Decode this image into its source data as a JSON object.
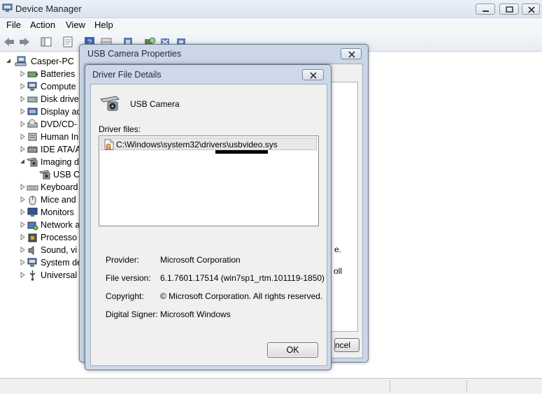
{
  "window": {
    "title": "Device Manager",
    "icon": "device-manager-icon"
  },
  "menu": {
    "file": "File",
    "action": "Action",
    "view": "View",
    "help": "Help"
  },
  "toolbar": {
    "icons": [
      "back-arrow-icon",
      "forward-arrow-icon",
      "console-tree-icon",
      "properties-icon",
      "help-icon",
      "grid-icon",
      "update-driver-icon",
      "scan-hardware-icon",
      "uninstall-icon",
      "disable-icon"
    ]
  },
  "tree": {
    "root": "Casper-PC",
    "items": [
      {
        "label": "Batteries",
        "icon": "battery-icon"
      },
      {
        "label": "Compute",
        "icon": "computer-icon"
      },
      {
        "label": "Disk drive",
        "icon": "disk-drive-icon"
      },
      {
        "label": "Display ad",
        "icon": "display-adapter-icon"
      },
      {
        "label": "DVD/CD-",
        "icon": "dvd-drive-icon"
      },
      {
        "label": "Human In",
        "icon": "hid-icon"
      },
      {
        "label": "IDE ATA/A",
        "icon": "ide-controller-icon"
      },
      {
        "label": "Imaging d",
        "icon": "camera-icon"
      },
      {
        "label": "USB C",
        "icon": "usb-camera-icon"
      },
      {
        "label": "Keyboard",
        "icon": "keyboard-icon"
      },
      {
        "label": "Mice and",
        "icon": "mouse-icon"
      },
      {
        "label": "Monitors",
        "icon": "monitor-icon"
      },
      {
        "label": "Network a",
        "icon": "network-adapter-icon"
      },
      {
        "label": "Processo",
        "icon": "processor-icon"
      },
      {
        "label": "Sound, vi",
        "icon": "sound-icon"
      },
      {
        "label": "System de",
        "icon": "system-devices-icon"
      },
      {
        "label": "Universal",
        "icon": "usb-controller-icon"
      }
    ]
  },
  "properties_dialog": {
    "title": "USB Camera Properties",
    "fragment_1": "e.",
    "fragment_2": "oll",
    "cancel_fragment": "ncel"
  },
  "details_dialog": {
    "title": "Driver File Details",
    "device_name": "USB Camera",
    "files_label": "Driver files:",
    "files": [
      "C:\\Windows\\system32\\drivers\\usbvideo.sys"
    ],
    "provider_label": "Provider:",
    "provider": "Microsoft Corporation",
    "file_version_label": "File version:",
    "file_version": "6.1.7601.17514 (win7sp1_rtm.101119-1850)",
    "copyright_label": "Copyright:",
    "copyright": "© Microsoft Corporation. All rights reserved.",
    "signer_label": "Digital Signer:",
    "signer": "Microsoft Windows",
    "ok_label": "OK"
  }
}
